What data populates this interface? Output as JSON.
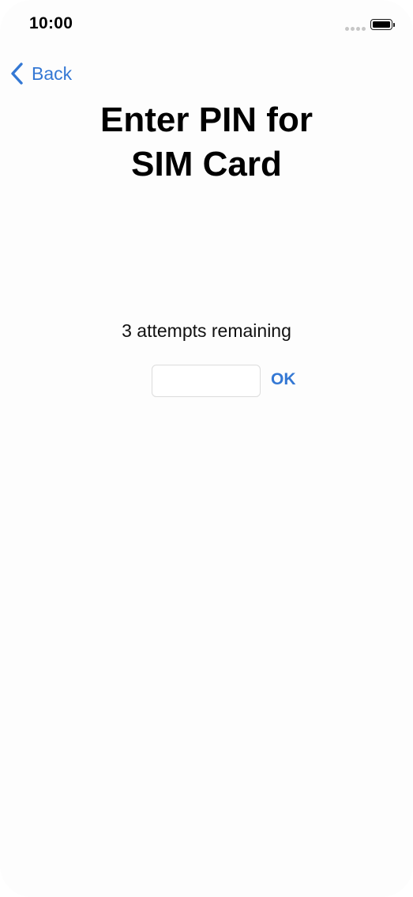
{
  "status_bar": {
    "time": "10:00",
    "signal_icon": "signal-dots-icon",
    "battery_icon": "battery-full-icon",
    "battery_level": 1.0
  },
  "nav": {
    "back_label": "Back",
    "back_icon": "chevron-left-icon"
  },
  "header": {
    "title_line1": "Enter PIN for",
    "title_line2": "SIM Card"
  },
  "pin_form": {
    "attempts_text": "3 attempts remaining",
    "pin_value": "",
    "pin_placeholder": "",
    "ok_label": "OK"
  },
  "colors": {
    "accent": "#3478d4",
    "background": "#fdfdfd",
    "text": "#000000"
  }
}
